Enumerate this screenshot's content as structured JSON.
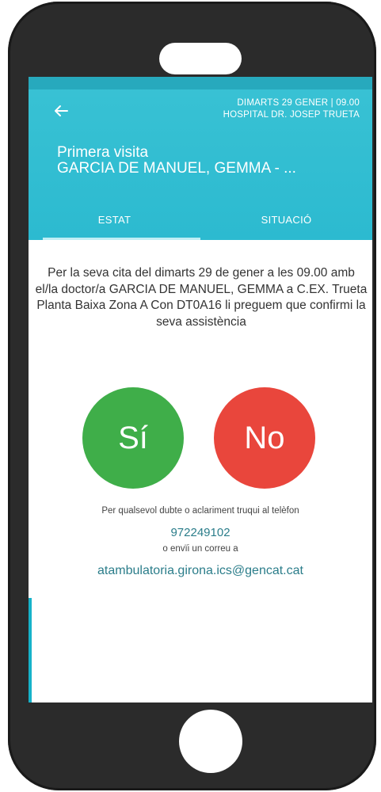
{
  "header": {
    "date_time": "DIMARTS 29 GENER | 09.00",
    "hospital": "HOSPITAL DR. JOSEP TRUETA",
    "visit_type": "Primera visita",
    "doctor": "GARCIA DE MANUEL, GEMMA - ..."
  },
  "tabs": [
    {
      "label": "ESTAT",
      "active": true
    },
    {
      "label": "SITUACIÓ",
      "active": false
    }
  ],
  "message": "Per la seva cita del dimarts 29 de gener a les 09.00 amb el/la doctor/a GARCIA DE MANUEL, GEMMA a C.EX. Trueta Planta Baixa Zona A Con DT0A16 li preguem que confirmi la seva assistència",
  "buttons": {
    "yes_label": "Sí",
    "no_label": "No"
  },
  "contact": {
    "help_text": "Per qualsevol dubte o aclariment truqui al telèfon",
    "phone": "972249102",
    "or_text": "o envïi un correu a",
    "email": "atambulatoria.girona.ics@gencat.cat"
  },
  "colors": {
    "header": "#2cbad0",
    "yes": "#3fae49",
    "no": "#e9463c",
    "link": "#2b7d8a"
  }
}
